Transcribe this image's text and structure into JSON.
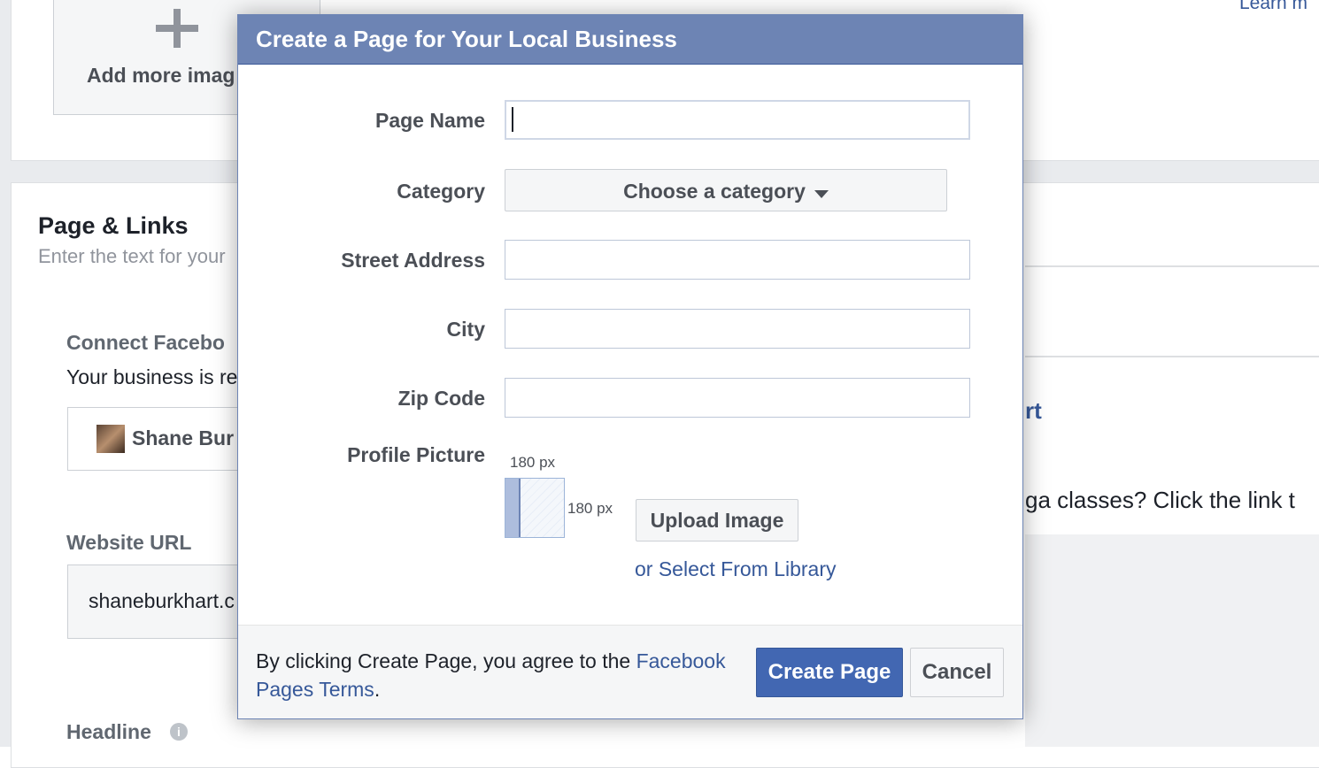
{
  "background": {
    "add_images_label": "Add more imag",
    "learn_more_link": "Learn m",
    "section_title": "Page & Links",
    "section_subtitle": "Enter the text for your",
    "connect_label": "Connect Facebo",
    "connect_text": "Your business is re",
    "account_name": "Shane Bur",
    "website_url_label": "Website URL",
    "website_url_value": "shaneburkhart.c",
    "headline_label": "Headline",
    "help_icon_glyph": "i",
    "preview_name": "rt",
    "preview_text": "ga classes? Click the link t"
  },
  "modal": {
    "title": "Create a Page for Your Local Business",
    "fields": {
      "page_name_label": "Page Name",
      "page_name_value": "",
      "category_label": "Category",
      "category_placeholder": "Choose a category",
      "street_label": "Street Address",
      "street_value": "",
      "city_label": "City",
      "city_value": "",
      "zip_label": "Zip Code",
      "zip_value": "",
      "profile_picture_label": "Profile Picture",
      "px_width": "180 px",
      "px_height": "180 px"
    },
    "upload_button": "Upload Image",
    "library_link": "or Select From Library",
    "footer": {
      "text_before": "By clicking Create Page, you agree to the ",
      "terms_link": "Facebook Pages Terms",
      "text_after": ".",
      "create_button": "Create Page",
      "cancel_button": "Cancel"
    }
  },
  "colors": {
    "header_bg": "#6d84b4",
    "primary_button": "#4267b2",
    "link": "#365899"
  }
}
